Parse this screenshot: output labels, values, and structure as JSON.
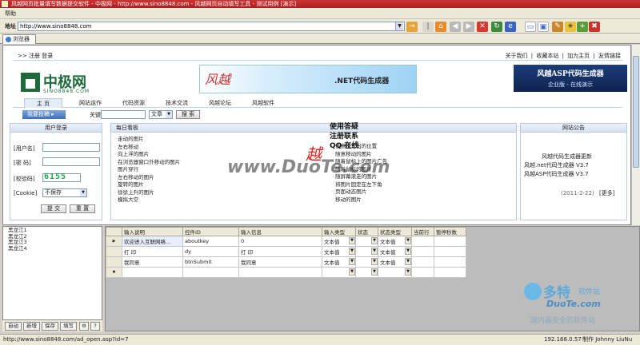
{
  "window": {
    "title": "风越网页批量填写数据提交软件 - 中极网 - http://www.sino8848.com - 风越网页自动填写工具 - 测试用例 [演示]"
  },
  "menu": {
    "help": "帮助"
  },
  "address": {
    "label": "地址",
    "url": "http://www.sino8848.com"
  },
  "tab": {
    "label": "浏览器"
  },
  "site": {
    "top_left": ">> 注册  登录",
    "top_right": [
      "关于我们",
      "收藏本站",
      "加为主页",
      "友情链接"
    ],
    "logo_name": "中极网",
    "logo_domain": "SINO8848.COM",
    "banner1_logo": "风越",
    "banner1_text": ".NET代码生成器",
    "banner2_title": "风越ASP代码生成器",
    "banner2_sub": "企业版 - 在线演示",
    "nav": [
      "主 页",
      "网站运作",
      "代码资源",
      "技术交流",
      "风越论坛",
      "风越软件"
    ],
    "search": {
      "dropdown": "我要投稿",
      "keyword_label": "关键字",
      "type_select": "文章",
      "button": "搜 索"
    },
    "login": {
      "header": "用户登录",
      "username_label": "[用户名]",
      "password_label": "[密  码]",
      "captcha_label": "[校验码]",
      "captcha_value": "6155",
      "cookie_label": "[Cookie]",
      "cookie_value": "不保存",
      "submit": "提 交",
      "reset": "重 置"
    },
    "daily": {
      "header": "每日看板",
      "left": [
        "走动的图片",
        "左右移动",
        "向上浮的图片",
        "在浏览器窗口外移动的图片",
        "图片穿行",
        "左右移动的图片",
        "旋转的图片",
        "徐徐上升的图片",
        "模拟大空"
      ],
      "right": [
        "任意指定出的位置",
        "随意移动的图片",
        "随着鼠标上的图片广告",
        "随着鼠标的图片",
        "随屏幕滚走的图片",
        "将图片固定在左下角",
        "页面动态图片",
        "移动的图片"
      ],
      "promo": [
        "使用答疑",
        "注册联系",
        "QQ 在线"
      ]
    },
    "notice": {
      "header": "网站公告",
      "title": "风越代码生成器更新",
      "line1": "风越.net代码生成器 V3.7",
      "line2": "风越ASP代码生成器 V3.7",
      "date": "(2011-2-22)",
      "more": "[更多]"
    }
  },
  "tree": {
    "items": [
      "黑龙江1",
      "黑龙江2",
      "黑龙江3",
      "黑龙江4"
    ]
  },
  "left_buttons": [
    "自动",
    "新增",
    "保存",
    "填写"
  ],
  "grid": {
    "columns": [
      "输入说明",
      "控件ID",
      "输入信息",
      "输入类型",
      "状态",
      "状态类型",
      "当前行",
      "暂停秒数"
    ],
    "rows": [
      [
        "欢迎进入互联网络...",
        "aboutkey",
        "0",
        "文本值",
        "",
        "文本值",
        "",
        ""
      ],
      [
        "打 印",
        "dy",
        "打 印",
        "文本值",
        "",
        "文本值",
        "",
        ""
      ],
      [
        "我同意",
        "btnSubmit",
        "我同意",
        "文本值",
        "",
        "文本值",
        "",
        ""
      ]
    ]
  },
  "status": {
    "url": "http://www.sino8848.com/ad_open.asp?id=7",
    "ip": "192.168.0.57",
    "author": "制作 Johnny LiuNu"
  },
  "watermarks": {
    "center": "www.DuoTe.com",
    "brand_cn": "多特",
    "brand_sub": "软件站",
    "brand_en": "DuoTe.com",
    "slogan": "国内最安全的软件站"
  },
  "colors": {
    "accent": "#3f71b8",
    "logo_green": "#1e6a3a",
    "captcha_green": "#1fa64a"
  }
}
